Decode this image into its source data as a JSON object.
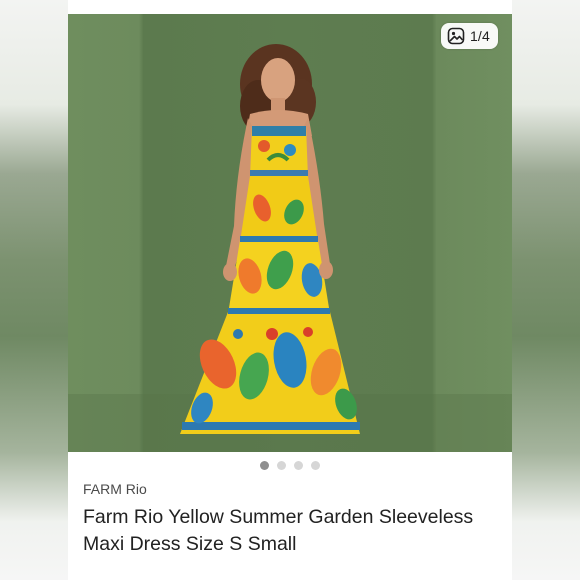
{
  "gallery": {
    "counter_text": "1/4",
    "counter_icon": "image-gallery-icon",
    "total_images": 4,
    "active_index": 0
  },
  "listing": {
    "brand": "FARM Rio",
    "title": "Farm Rio Yellow Summer Garden Sleeveless Maxi Dress Size S Small"
  },
  "colors": {
    "backdrop_green": "#5e7d50",
    "dress_yellow": "#f2cf1c",
    "dot_active": "#8f8f8f",
    "dot_inactive": "#d6d6d6"
  }
}
